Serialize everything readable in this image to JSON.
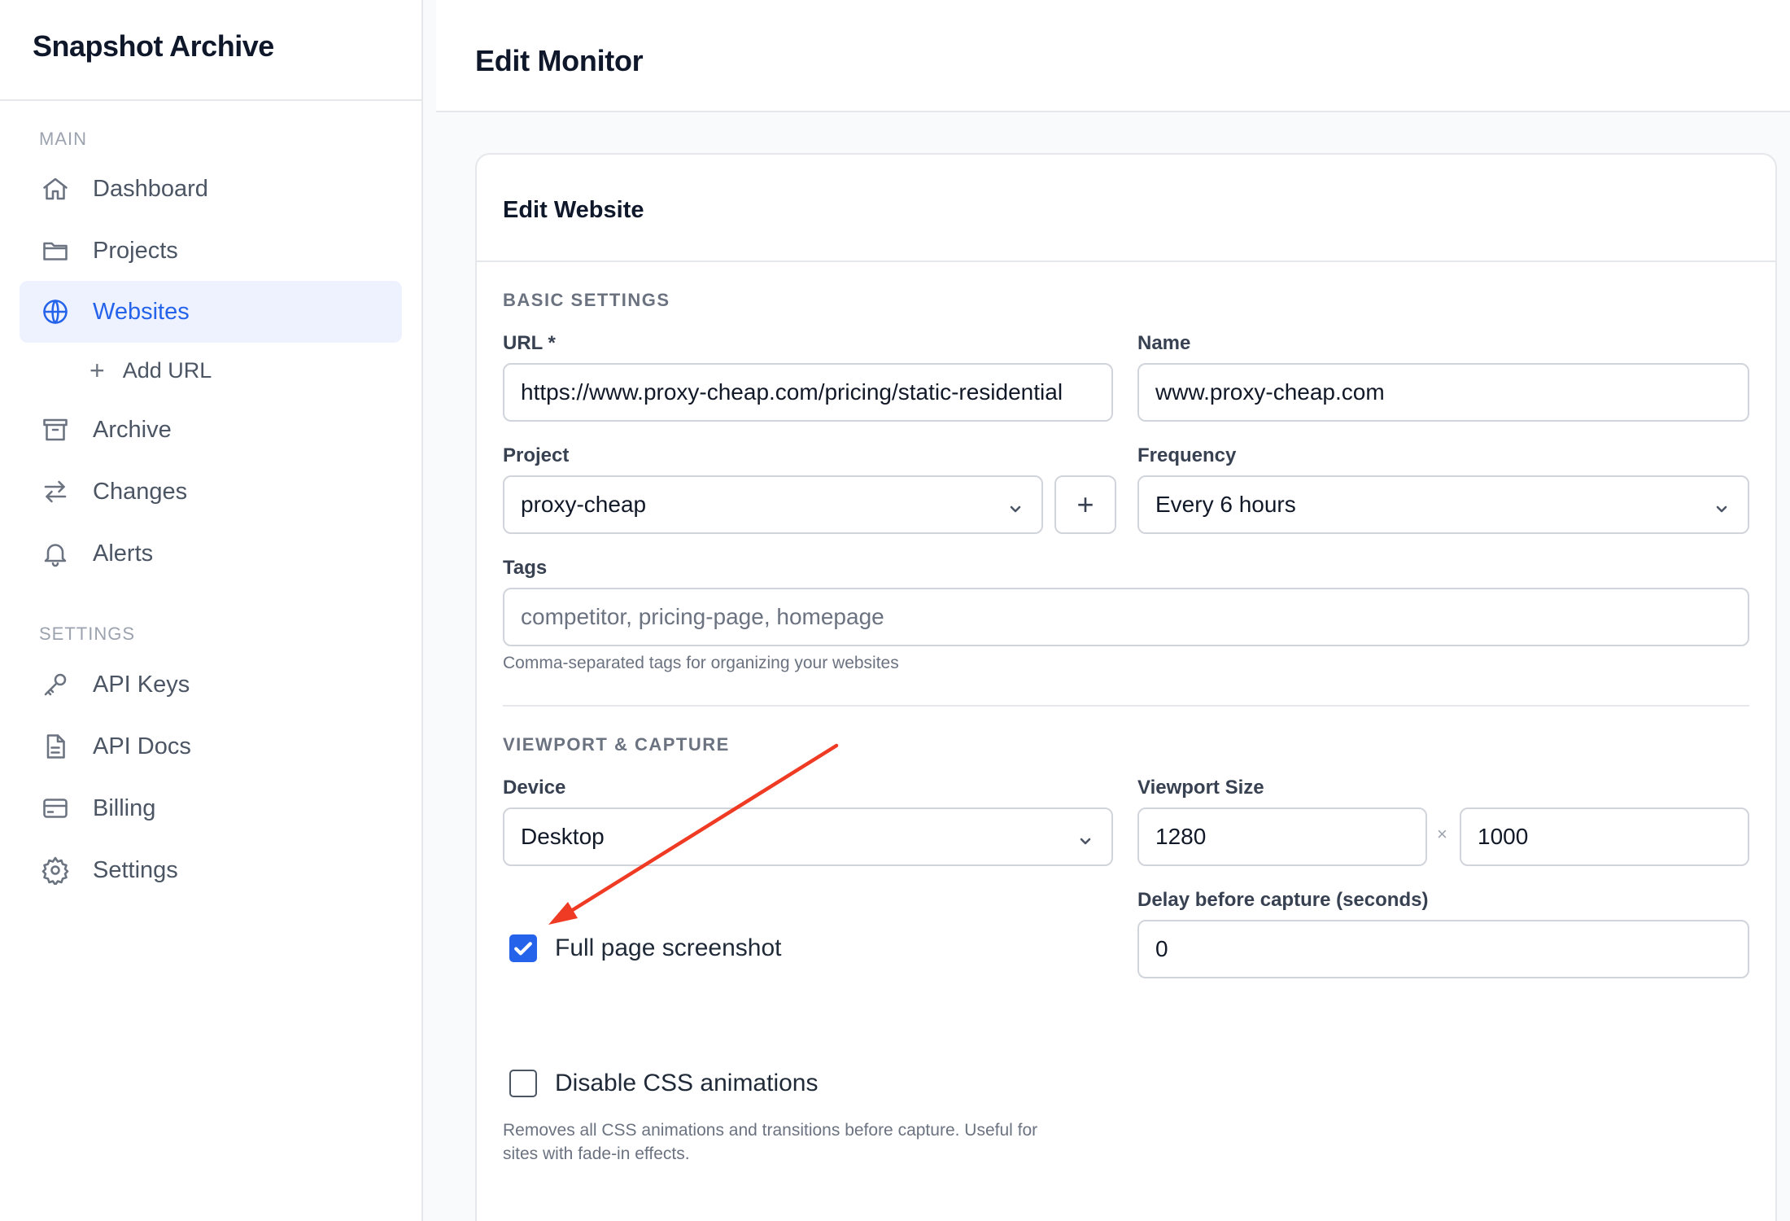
{
  "app": {
    "brand": "Snapshot Archive"
  },
  "sidebar": {
    "main_label": "MAIN",
    "settings_label": "SETTINGS",
    "items": [
      {
        "label": "Dashboard",
        "icon": "home-icon"
      },
      {
        "label": "Projects",
        "icon": "folder-icon"
      },
      {
        "label": "Websites",
        "icon": "globe-icon",
        "active": true
      },
      {
        "label": "Archive",
        "icon": "archive-icon"
      },
      {
        "label": "Changes",
        "icon": "arrows-swap-icon"
      },
      {
        "label": "Alerts",
        "icon": "bell-icon"
      }
    ],
    "sub_item": {
      "label": "Add URL",
      "icon": "plus-icon"
    },
    "settings_items": [
      {
        "label": "API Keys",
        "icon": "key-icon"
      },
      {
        "label": "API Docs",
        "icon": "document-icon"
      },
      {
        "label": "Billing",
        "icon": "credit-card-icon"
      },
      {
        "label": "Settings",
        "icon": "gear-icon"
      }
    ]
  },
  "header": {
    "title": "Edit Monitor"
  },
  "card": {
    "title": "Edit Website",
    "basic_section": "BASIC SETTINGS",
    "url": {
      "label": "URL *",
      "value": "https://www.proxy-cheap.com/pricing/static-residential"
    },
    "name": {
      "label": "Name",
      "value": "www.proxy-cheap.com"
    },
    "project": {
      "label": "Project",
      "value": "proxy-cheap",
      "add_label": "+"
    },
    "frequency": {
      "label": "Frequency",
      "value": "Every 6 hours"
    },
    "tags": {
      "label": "Tags",
      "placeholder": "competitor, pricing-page, homepage",
      "help": "Comma-separated tags for organizing your websites"
    },
    "viewport_section": "VIEWPORT & CAPTURE",
    "device": {
      "label": "Device",
      "value": "Desktop"
    },
    "viewport": {
      "label": "Viewport Size",
      "width": "1280",
      "height": "1000",
      "separator": "×"
    },
    "delay": {
      "label": "Delay before capture (seconds)",
      "value": "0"
    },
    "full_page": {
      "label": "Full page screenshot",
      "checked": true
    },
    "disable_css": {
      "label": "Disable CSS animations",
      "checked": false,
      "help_line1": "Removes all CSS animations and transitions before capture. Useful for",
      "help_line2": "sites with fade-in effects."
    }
  },
  "colors": {
    "accent": "#2563eb",
    "annotation_arrow": "#ef3a24"
  }
}
